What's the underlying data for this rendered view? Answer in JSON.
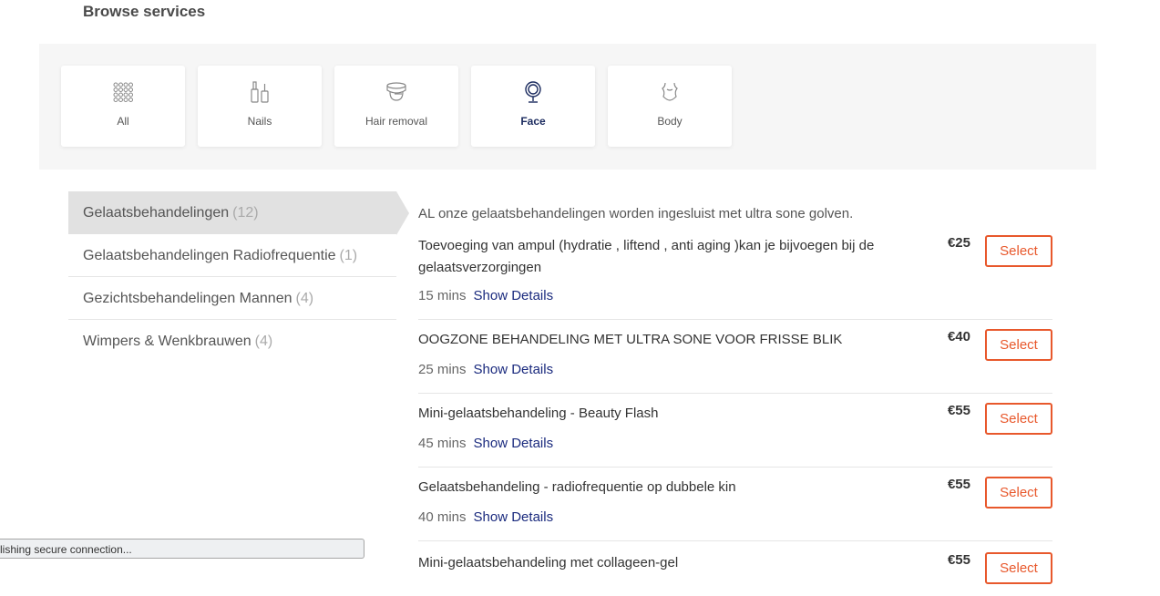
{
  "page": {
    "title": "Browse services"
  },
  "categories": [
    {
      "label": "All",
      "icon": "grid-dots-icon",
      "active": false
    },
    {
      "label": "Nails",
      "icon": "nail-polish-icon",
      "active": false
    },
    {
      "label": "Hair removal",
      "icon": "wax-icon",
      "active": false
    },
    {
      "label": "Face",
      "icon": "face-mirror-icon",
      "active": true
    },
    {
      "label": "Body",
      "icon": "body-icon",
      "active": false
    }
  ],
  "sidebar": {
    "items": [
      {
        "label": "Gelaatsbehandelingen",
        "count": "(12)",
        "active": true
      },
      {
        "label": "Gelaatsbehandelingen Radiofrequentie",
        "count": "(1)",
        "active": false
      },
      {
        "label": "Gezichtsbehandelingen Mannen",
        "count": "(4)",
        "active": false
      },
      {
        "label": "Wimpers & Wenkbrauwen",
        "count": "(4)",
        "active": false
      }
    ]
  },
  "main": {
    "intro": "AL onze gelaatsbehandelingen worden ingesluist met ultra sone golven.",
    "details_label": "Show Details",
    "select_label": "Select",
    "services": [
      {
        "name": "Toevoeging van ampul (hydratie , liftend , anti aging )kan je bijvoegen bij de gelaatsverzorgingen",
        "duration": "15 mins",
        "price": "€25"
      },
      {
        "name": "OOGZONE BEHANDELING MET ULTRA SONE VOOR FRISSE BLIK",
        "duration": "25 mins",
        "price": "€40"
      },
      {
        "name": "Mini-gelaatsbehandeling - Beauty Flash",
        "duration": "45 mins",
        "price": "€55"
      },
      {
        "name": "Gelaatsbehandeling - radiofrequentie op dubbele kin",
        "duration": "40 mins",
        "price": "€55"
      },
      {
        "name": "Mini-gelaatsbehandeling met collageen-gel",
        "duration": "",
        "price": "€55"
      }
    ]
  },
  "status": {
    "text": "lishing secure connection..."
  },
  "colors": {
    "accent": "#e8582c",
    "link": "#1a2a7e",
    "active_bg": "#e1e1e1"
  }
}
